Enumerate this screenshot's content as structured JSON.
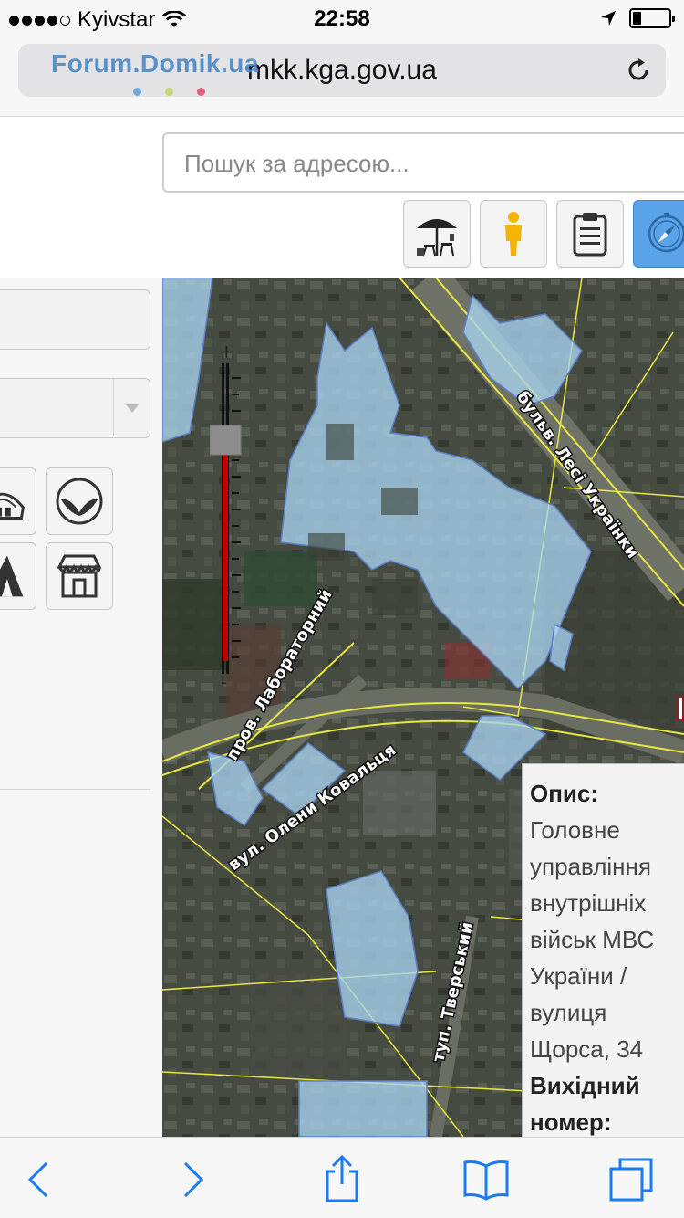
{
  "status_bar": {
    "carrier": "Kyivstar",
    "time": "22:58",
    "signal_bars_filled": 4,
    "battery_level_percent": 20
  },
  "browser": {
    "url": "mkk.kga.gov.ua",
    "watermark": "Forum.Domik.ua"
  },
  "search": {
    "placeholder": "Пошук за адресою..."
  },
  "toolbar": {
    "buttons": [
      {
        "icon": "beach-umbrella-icon"
      },
      {
        "icon": "pegman-icon"
      },
      {
        "icon": "clipboard-icon"
      },
      {
        "icon": "compass-icon",
        "active": true
      }
    ]
  },
  "left_panel": {
    "field_value": "",
    "select_value": "",
    "icon_buttons": [
      "roof-icon",
      "hands-icon",
      "tent-icon",
      "shop-icon"
    ]
  },
  "map": {
    "street_labels": [
      "бульв. Лесі Українки",
      "пров. Лабораторний",
      "вул. Олени Ковальця",
      "туп. Тверський"
    ],
    "popup": {
      "label_description": "Опис:",
      "description_lines": [
        "Головне",
        "управління",
        "внутрішніх",
        "військ МВС",
        "України /",
        "вулиця",
        "Щорса, 34"
      ],
      "label_outgoing_number_line1": "Вихідний",
      "label_outgoing_number_line2": "номер:"
    },
    "colors": {
      "parcel_fill": "#a8d4f0",
      "road_line": "#e8e840",
      "zoom_bar": "#c00000"
    }
  },
  "bottom_bar": {
    "items": [
      "back-icon",
      "forward-icon",
      "share-icon",
      "bookmarks-icon",
      "tabs-icon"
    ]
  }
}
